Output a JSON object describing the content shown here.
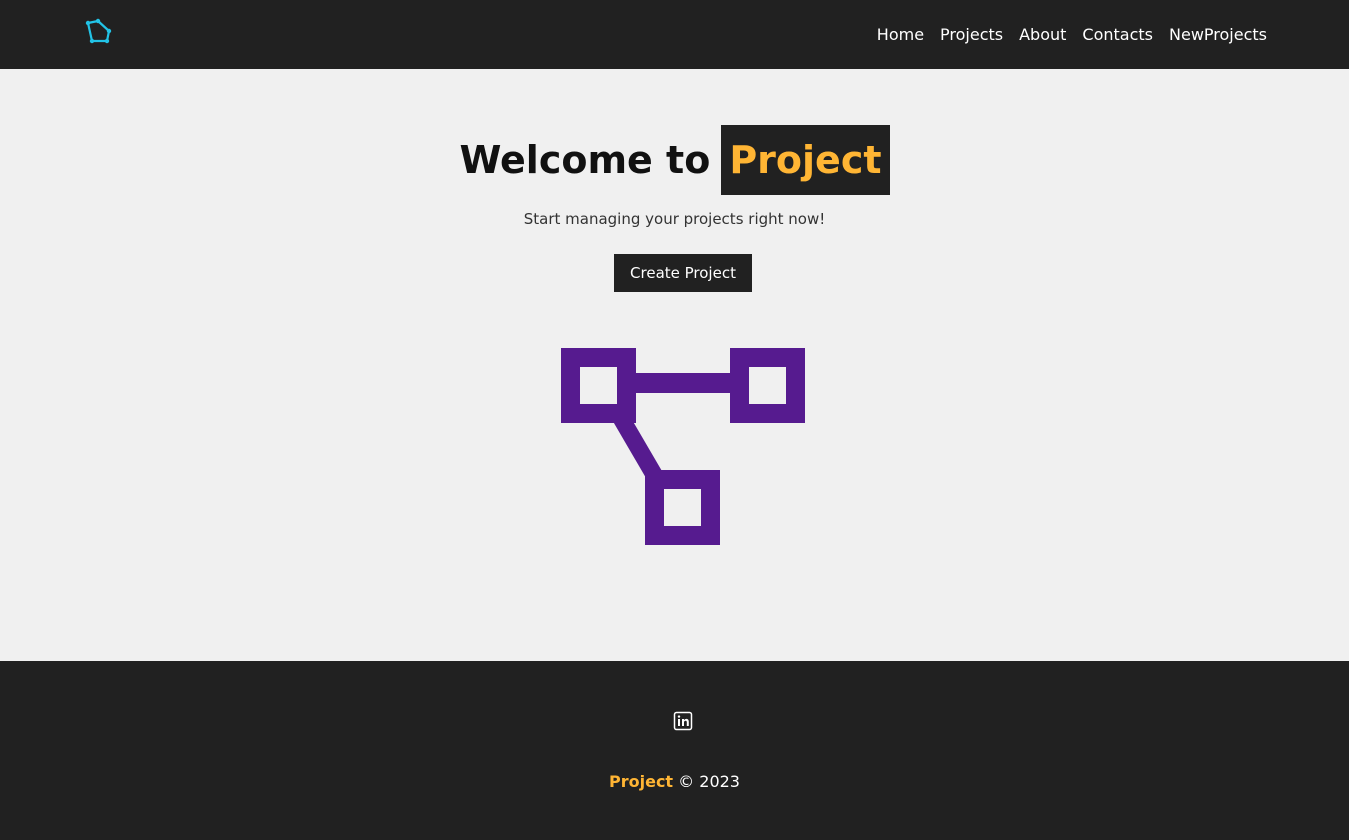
{
  "navbar": {
    "logo_icon": "network-logo-icon",
    "links": [
      "Home",
      "Projects",
      "About",
      "Contacts",
      "NewProjects"
    ]
  },
  "hero": {
    "title_prefix": "Welcome to",
    "title_highlight": "Project",
    "subtitle": "Start managing your projects right now!",
    "button_label": "Create Project",
    "graphic_icon": "project-network-icon"
  },
  "footer": {
    "social_icon": "linkedin-icon",
    "brand": "Project",
    "copyright": "© 2023"
  },
  "colors": {
    "dark": "#212121",
    "background": "#f0f0f0",
    "accent": "#ffb534",
    "graphic": "#561b8f",
    "logo": "#22c3e6"
  }
}
